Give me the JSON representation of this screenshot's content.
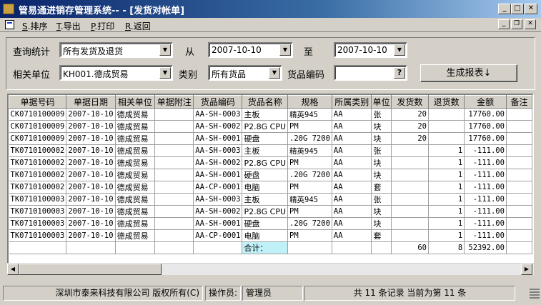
{
  "window": {
    "title": "管易通进销存管理系统-- - [发货对帐单]"
  },
  "menu": [
    {
      "key": "S",
      "label": ".排序"
    },
    {
      "key": "T",
      "label": ".导出"
    },
    {
      "key": "P",
      "label": ".打印"
    },
    {
      "key": "R",
      "label": ".返回"
    }
  ],
  "filters": {
    "query_label": "查询统计",
    "query_value": "所有发货及退货",
    "from_label": "从",
    "from_value": "2007-10-10",
    "to_label": "至",
    "to_value": "2007-10-10",
    "unit_label": "相关单位",
    "unit_value": "KH001.德成贸易",
    "category_label": "类别",
    "category_value": "所有货品",
    "code_label": "货品编码",
    "code_value": "",
    "lookup_symbol": "?",
    "generate_label": "生成报表↓"
  },
  "table": {
    "headers": [
      "单据号码",
      "单据日期",
      "相关单位",
      "单据附注",
      "货品编码",
      "货品名称",
      "规格",
      "所属类别",
      "单位",
      "发货数",
      "退货数",
      "金额",
      "备注"
    ],
    "rows": [
      [
        "CK0710100009",
        "2007-10-10",
        "德成贸易",
        "",
        "AA-SH-0003",
        "主板",
        "精英945",
        "AA",
        "张",
        "20",
        "",
        "17760.00",
        ""
      ],
      [
        "CK0710100009",
        "2007-10-10",
        "德成贸易",
        "",
        "AA-SH-0002",
        "P2.8G CPU",
        "PM",
        "AA",
        "块",
        "20",
        "",
        "17760.00",
        ""
      ],
      [
        "CK0710100009",
        "2007-10-10",
        "德成贸易",
        "",
        "AA-SH-0001",
        "硬盘",
        ".20G 7200",
        "AA",
        "块",
        "20",
        "",
        "17760.00",
        ""
      ],
      [
        "TK0710100002",
        "2007-10-10",
        "德成贸易",
        "",
        "AA-SH-0003",
        "主板",
        "精英945",
        "AA",
        "张",
        "",
        "1",
        "-111.00",
        ""
      ],
      [
        "TK0710100002",
        "2007-10-10",
        "德成贸易",
        "",
        "AA-SH-0002",
        "P2.8G CPU",
        "PM",
        "AA",
        "块",
        "",
        "1",
        "-111.00",
        ""
      ],
      [
        "TK0710100002",
        "2007-10-10",
        "德成贸易",
        "",
        "AA-SH-0001",
        "硬盘",
        ".20G 7200",
        "AA",
        "块",
        "",
        "1",
        "-111.00",
        ""
      ],
      [
        "TK0710100002",
        "2007-10-10",
        "德成贸易",
        "",
        "AA-CP-0001",
        "电脑",
        "PM",
        "AA",
        "套",
        "",
        "1",
        "-111.00",
        ""
      ],
      [
        "TK0710100003",
        "2007-10-10",
        "德成贸易",
        "",
        "AA-SH-0003",
        "主板",
        "精英945",
        "AA",
        "张",
        "",
        "1",
        "-111.00",
        ""
      ],
      [
        "TK0710100003",
        "2007-10-10",
        "德成贸易",
        "",
        "AA-SH-0002",
        "P2.8G CPU",
        "PM",
        "AA",
        "块",
        "",
        "1",
        "-111.00",
        ""
      ],
      [
        "TK0710100003",
        "2007-10-10",
        "德成贸易",
        "",
        "AA-SH-0001",
        "硬盘",
        ".20G 7200",
        "AA",
        "块",
        "",
        "1",
        "-111.00",
        ""
      ],
      [
        "TK0710100003",
        "2007-10-10",
        "德成贸易",
        "",
        "AA-CP-0001",
        "电脑",
        "PM",
        "AA",
        "套",
        "",
        "1",
        "-111.00",
        ""
      ]
    ],
    "total_row": [
      "",
      "",
      "",
      "",
      "",
      "合计：",
      "",
      "",
      "",
      "60",
      "8",
      "52392.00",
      ""
    ]
  },
  "status": {
    "company": "深圳市泰来科技有限公司 版权所有(C)",
    "operator_label": "操作员:",
    "operator": "管理员",
    "records": "共 11 条记录 当前为第 11 条"
  }
}
